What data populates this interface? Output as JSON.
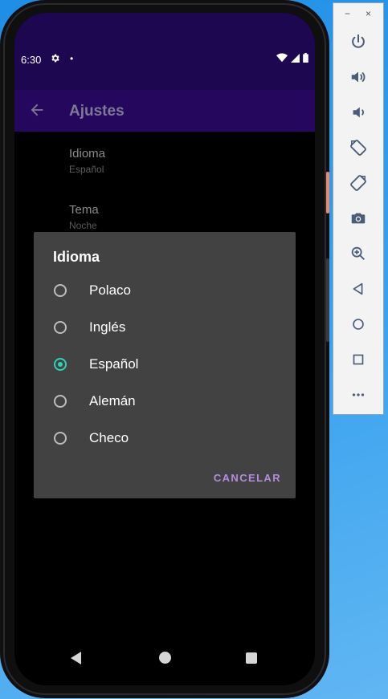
{
  "status_bar": {
    "time": "6:30",
    "gear_icon": "settings-icon",
    "dot": "•"
  },
  "app_bar": {
    "title": "Ajustes",
    "back_icon": "arrow-left-icon"
  },
  "preferences": [
    {
      "title": "Idioma",
      "summary": "Español"
    },
    {
      "title": "Tema",
      "summary": "Noche"
    }
  ],
  "dialog": {
    "title": "Idioma",
    "options": [
      {
        "label": "Polaco",
        "checked": false
      },
      {
        "label": "Inglés",
        "checked": false
      },
      {
        "label": "Español",
        "checked": true
      },
      {
        "label": "Alemán",
        "checked": false
      },
      {
        "label": "Checo",
        "checked": false
      }
    ],
    "cancel_label": "CANCELAR"
  },
  "emulator_toolbar": {
    "minimize": "−",
    "close": "×",
    "tools": [
      "power-icon",
      "volume-up-icon",
      "volume-down-icon",
      "rotate-left-icon",
      "rotate-right-icon",
      "camera-icon",
      "zoom-icon",
      "back-icon",
      "home-icon",
      "overview-icon",
      "more-icon"
    ]
  },
  "colors": {
    "status_bar": "#1e0751",
    "app_bar": "#25085e",
    "dialog_bg": "#424242",
    "radio_checked": "#2ed3b7",
    "cancel_text": "#b48be0"
  }
}
